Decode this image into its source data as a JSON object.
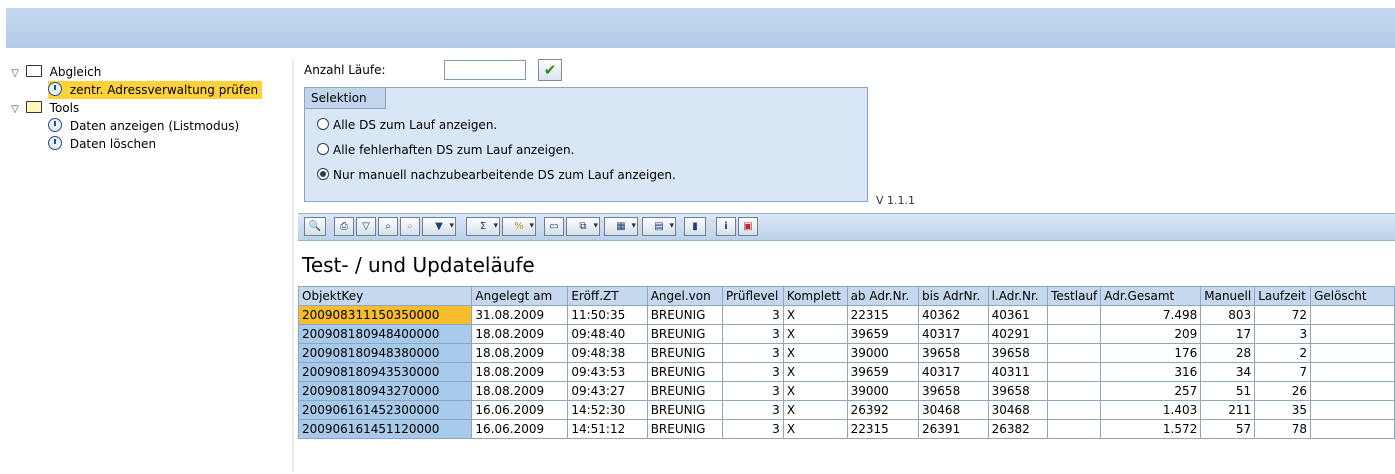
{
  "header": {
    "title": ""
  },
  "tree": {
    "items": [
      {
        "label": "Abgleich",
        "icon": "folder-icon",
        "expanded": true
      },
      {
        "label": "zentr. Adressverwaltung prüfen",
        "icon": "clock-icon",
        "selected": true
      },
      {
        "label": "Tools",
        "icon": "folder-open-icon",
        "expanded": true
      },
      {
        "label": "Daten anzeigen (Listmodus)",
        "icon": "clock-icon"
      },
      {
        "label": "Daten löschen",
        "icon": "clock-icon"
      }
    ]
  },
  "form": {
    "laufe_label": "Anzahl Läufe:",
    "laufe_value": "",
    "execute_icon": "checkmark-icon"
  },
  "selektion": {
    "title": "Selektion",
    "options": [
      {
        "label": "Alle DS zum Lauf anzeigen.",
        "checked": false
      },
      {
        "label": "Alle fehlerhaften DS zum Lauf anzeigen.",
        "checked": false
      },
      {
        "label": "Nur manuell nachzubearbeitende DS zum Lauf anzeigen.",
        "checked": true
      }
    ],
    "version": "V 1.1.1"
  },
  "toolbar": {
    "buttons": [
      "details-icon",
      "print-icon",
      "filter-icon",
      "find-icon",
      "find-next-icon",
      "set-filter-icon",
      "sum-icon",
      "subtotal-icon",
      "print-preview-icon",
      "export-icon",
      "spreadsheet-icon",
      "layout-icon",
      "graphic-icon",
      "info-icon",
      "exit-icon"
    ]
  },
  "list": {
    "title": "Test- / und Updateläufe",
    "columns": [
      "ObjektKey",
      "Angelegt am",
      "Eröff.ZT",
      "Angel.von",
      "Prüflevel",
      "Komplett",
      "ab Adr.Nr.",
      "bis AdrNr.",
      "l.Adr.Nr.",
      "Testlauf",
      "Adr.Gesamt",
      "Manuell",
      "Laufzeit",
      "Gelöscht"
    ],
    "rows": [
      [
        "200908311150350000",
        "31.08.2009",
        "11:50:35",
        "BREUNIG",
        "3",
        "X",
        "22315",
        "40362",
        "40361",
        "",
        "7.498",
        "803",
        "72",
        ""
      ],
      [
        "200908180948400000",
        "18.08.2009",
        "09:48:40",
        "BREUNIG",
        "3",
        "X",
        "39659",
        "40317",
        "40291",
        "",
        "209",
        "17",
        "3",
        ""
      ],
      [
        "200908180948380000",
        "18.08.2009",
        "09:48:38",
        "BREUNIG",
        "3",
        "X",
        "39000",
        "39658",
        "39658",
        "",
        "176",
        "28",
        "2",
        ""
      ],
      [
        "200908180943530000",
        "18.08.2009",
        "09:43:53",
        "BREUNIG",
        "3",
        "X",
        "39659",
        "40317",
        "40311",
        "",
        "316",
        "34",
        "7",
        ""
      ],
      [
        "200908180943270000",
        "18.08.2009",
        "09:43:27",
        "BREUNIG",
        "3",
        "X",
        "39000",
        "39658",
        "39658",
        "",
        "257",
        "51",
        "26",
        ""
      ],
      [
        "200906161452300000",
        "16.06.2009",
        "14:52:30",
        "BREUNIG",
        "3",
        "X",
        "26392",
        "30468",
        "30468",
        "",
        "1.403",
        "211",
        "35",
        ""
      ],
      [
        "200906161451120000",
        "16.06.2009",
        "14:51:12",
        "BREUNIG",
        "3",
        "X",
        "22315",
        "26391",
        "26382",
        "",
        "1.572",
        "57",
        "78",
        ""
      ]
    ]
  },
  "colors": {
    "header": "#b8cfea",
    "selected": "#ffd23b",
    "key_column": "#a7c9ea",
    "active_cell": "#f7bd2c"
  }
}
